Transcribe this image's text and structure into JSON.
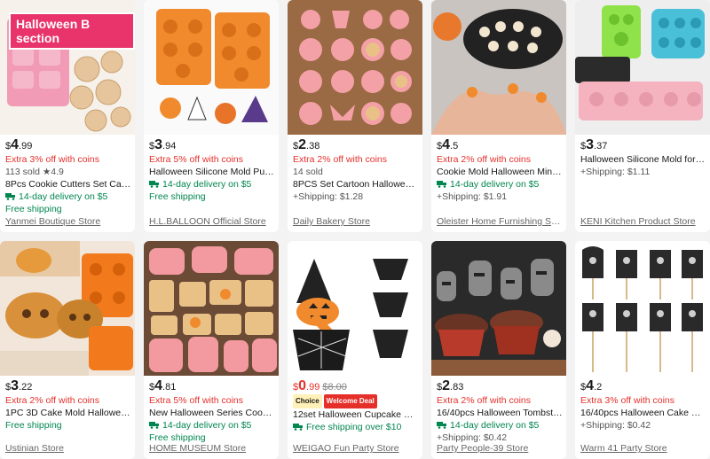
{
  "products": [
    {
      "price_cur": "$",
      "price_int": "4",
      "price_dec": ".99",
      "promo": "Extra 3% off with coins",
      "sold": "113 sold",
      "rating": "4.9",
      "title": "8Pcs Cookie Cutters Set Cartoon O...",
      "delivery": "14-day delivery on $5",
      "shipping": "Free shipping",
      "store": "Yanmei Boutique Store",
      "image_label": "Halloween B section"
    },
    {
      "price_cur": "$",
      "price_int": "3",
      "price_dec": ".94",
      "promo": "Extra 5% off with coins",
      "title": "Halloween Silicone Mold Pumpkin ...",
      "delivery": "14-day delivery on $5",
      "shipping": "Free shipping",
      "store": "H.L.BALLOON Official Store"
    },
    {
      "price_cur": "$",
      "price_int": "2",
      "price_dec": ".38",
      "promo": "Extra 2% off with coins",
      "sold": "14 sold",
      "title": "8PCS Set Cartoon Halloween Biscu...",
      "shipping": "+Shipping: $1.28",
      "store": "Daily Bakery Store"
    },
    {
      "price_cur": "$",
      "price_int": "4",
      "price_dec": ".5",
      "promo": "Extra 2% off with coins",
      "title": "Cookie Mold Halloween Mini Ring ...",
      "delivery": "14-day delivery on $5",
      "shipping": "+Shipping: $1.91",
      "store": "Oleister Home Furnishing Store St..."
    },
    {
      "price_cur": "$",
      "price_int": "3",
      "price_dec": ".37",
      "title": "Halloween Silicone Mold for Bakin...",
      "shipping": "+Shipping: $1.11",
      "store": "KENI Kitchen Product Store"
    },
    {
      "price_cur": "$",
      "price_int": "3",
      "price_dec": ".22",
      "promo": "Extra 2% off with coins",
      "title": "1PC 3D Cake Mold Halloween Bro...",
      "shipping": "Free shipping",
      "store": "Ustinian Store"
    },
    {
      "price_cur": "$",
      "price_int": "4",
      "price_dec": ".81",
      "promo": "Extra 5% off with coins",
      "title": "New Halloween Series Cookie Mol...",
      "delivery": "14-day delivery on $5",
      "shipping": "Free shipping",
      "store": "HOME MUSEUM Store"
    },
    {
      "price_cur": "$",
      "price_int": "0",
      "price_dec": ".99",
      "old_price": "$8.00",
      "badge_choice": "Choice",
      "badge_deal": "Welcome Deal",
      "title": "12set Halloween Cupcake Wrappe...",
      "delivery": "Free shipping over $10",
      "store": "WEIGAO Fun Party Store"
    },
    {
      "price_cur": "$",
      "price_int": "2",
      "price_dec": ".83",
      "promo": "Extra 2% off with coins",
      "title": "16/40pcs Halloween Tombstone C...",
      "delivery": "14-day delivery on $5",
      "shipping": "+Shipping: $0.42",
      "store": "Party People-39 Store"
    },
    {
      "price_cur": "$",
      "price_int": "4",
      "price_dec": ".2",
      "promo": "Extra 3% off with coins",
      "title": "16/40pcs Halloween Cake Decorati...",
      "shipping": "+Shipping: $0.42",
      "store": "Warm 41 Party Store"
    }
  ],
  "colors": {
    "promo": "#e5302a",
    "delivery": "#00864f",
    "page_bg": "#f3f3f3"
  }
}
